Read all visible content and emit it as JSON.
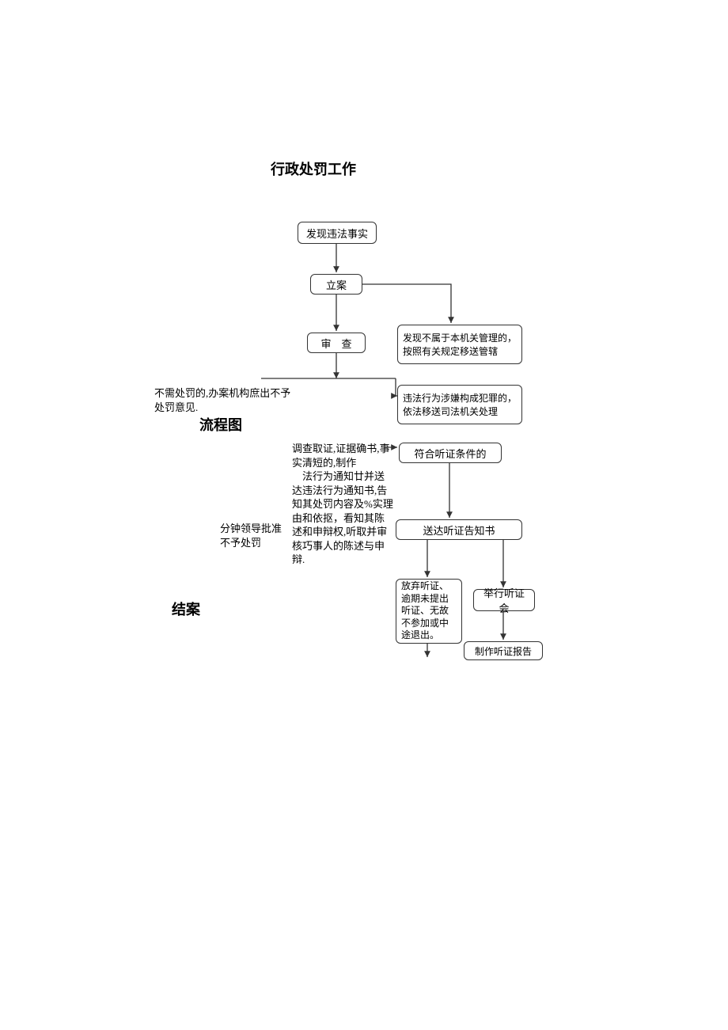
{
  "title": "行政处罚工作",
  "subtitle": "流程图",
  "closing": "结案",
  "nodes": {
    "discover": "发现违法事实",
    "file_case": "立案",
    "review": "审　查",
    "transfer_jurisdiction": "发现不属于本机关管理的，按照有关规定移送管辖",
    "criminal_transfer": "违法行为涉嫌构成犯罪的，依法移送司法机关处理",
    "hearing_condition": "符合听证条件的",
    "notice_delivery": "送达听证告知书",
    "waive_hearing": "放弃听证、逾期未提出听证、无故不参加或中途退出。",
    "hold_hearing": "举行听证会",
    "hearing_report": "制作听证报告"
  },
  "annotations": {
    "no_punish": "不需处罚的,办案机构庶出不予处罚意见.",
    "investigation": "调查取证,证据确书,事实清短的,制作\n　法行为通知廿并送达违法行为通知书,告知其处罚内容及%实理由和依抠，看知其陈述和申辩权,听取并审核巧事人的陈述与申辩.",
    "approve_no_punish": "分钟领导批准不予处罚"
  }
}
